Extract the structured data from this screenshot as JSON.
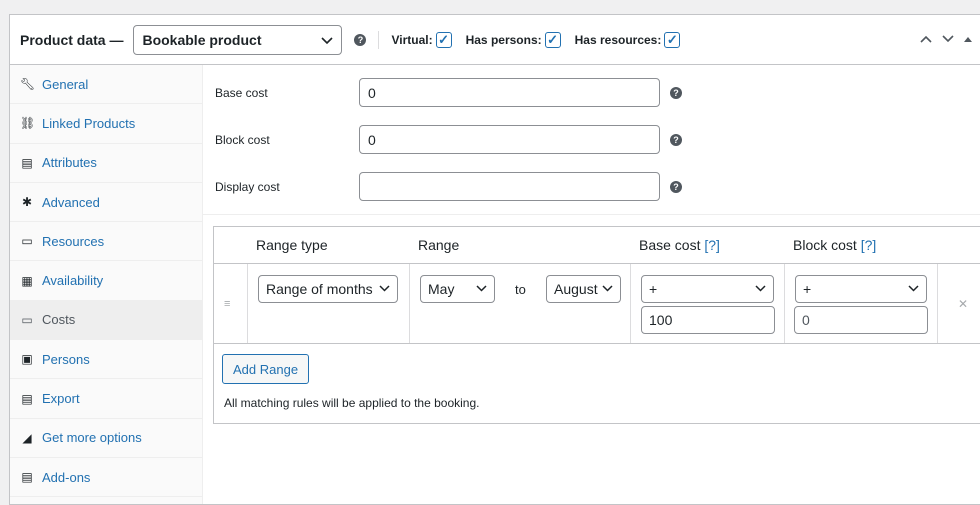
{
  "header": {
    "title": "Product data —",
    "product_type": "Bookable product",
    "virtual_label": "Virtual:",
    "virtual_checked": true,
    "has_persons_label": "Has persons:",
    "has_persons_checked": true,
    "has_resources_label": "Has resources:",
    "has_resources_checked": true,
    "controls": [
      "chevron-up-icon",
      "chevron-down-icon",
      "collapse-icon"
    ]
  },
  "sidebar": {
    "items": [
      {
        "label": "General",
        "icon": "wrench-icon"
      },
      {
        "label": "Linked Products",
        "icon": "link-icon"
      },
      {
        "label": "Attributes",
        "icon": "list-icon"
      },
      {
        "label": "Advanced",
        "icon": "gear-icon"
      },
      {
        "label": "Resources",
        "icon": "monitor-icon"
      },
      {
        "label": "Availability",
        "icon": "calendar-icon"
      },
      {
        "label": "Costs",
        "icon": "money-icon"
      },
      {
        "label": "Persons",
        "icon": "person-icon"
      },
      {
        "label": "Export",
        "icon": "export-icon"
      },
      {
        "label": "Get more options",
        "icon": "megaphone-icon"
      },
      {
        "label": "Add-ons",
        "icon": "addons-icon"
      }
    ],
    "active": "Costs"
  },
  "fields": {
    "base_cost": {
      "label": "Base cost",
      "value": "0"
    },
    "block_cost": {
      "label": "Block cost",
      "value": "0"
    },
    "display_cost": {
      "label": "Display cost",
      "value": ""
    }
  },
  "table": {
    "headers": {
      "range_type": "Range type",
      "range": "Range",
      "base_cost": "Base cost",
      "base_cost_link": "[?]",
      "block_cost": "Block cost",
      "block_cost_link": "[?]"
    },
    "row": {
      "range_type": "Range of months",
      "from": "May",
      "to_label": "to",
      "to": "August",
      "base_modifier": "+",
      "base_value": "100",
      "block_modifier": "+",
      "block_placeholder": "0",
      "drag_icon": "drag-handle-icon",
      "delete_icon": "close-icon"
    },
    "add_range_label": "Add Range",
    "note": "All matching rules will be applied to the booking."
  },
  "colors": {
    "accent": "#2271b1",
    "border": "#c3c4c7"
  }
}
